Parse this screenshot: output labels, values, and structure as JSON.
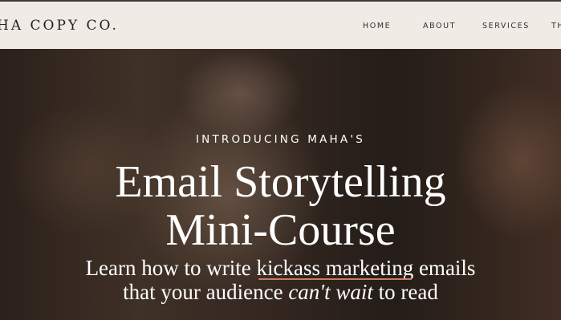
{
  "header": {
    "logo": "HA COPY CO.",
    "nav": [
      "HOME",
      "ABOUT",
      "SERVICES",
      "TH"
    ]
  },
  "hero": {
    "kicker": "INTRODUCING MAHA'S",
    "title_line1": "Email Storytelling",
    "title_line2": "Mini-Course",
    "sub1_pre": "Learn how to write ",
    "sub1_highlight": "kickass marketing",
    "sub1_post": " emails",
    "sub2_pre": "that your audience ",
    "sub2_em": "can't wait",
    "sub2_post": " to read"
  },
  "colors": {
    "header_bg": "#f0ebe5",
    "accent_underline": "#c87b5d"
  }
}
